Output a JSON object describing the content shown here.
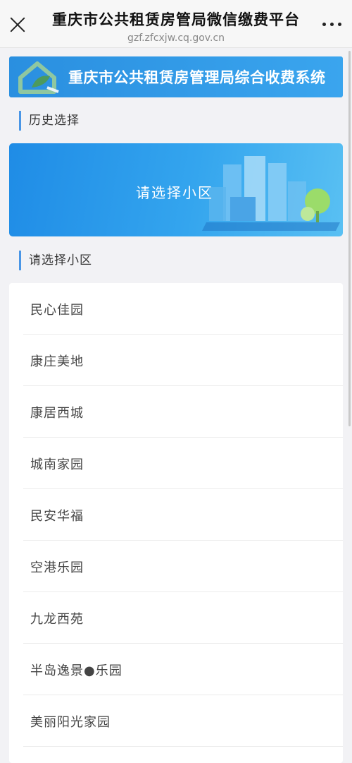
{
  "header": {
    "title": "重庆市公共租赁房管局微信缴费平台",
    "url": "gzf.zfcxjw.cq.gov.cn"
  },
  "banner": {
    "title": "重庆市公共租赁房管理局综合收费系统"
  },
  "history": {
    "heading": "历史选择",
    "card_label": "请选择小区"
  },
  "community": {
    "heading": "请选择小区",
    "items": [
      {
        "label": "民心佳园"
      },
      {
        "label": "康庄美地"
      },
      {
        "label": "康居西城"
      },
      {
        "label": "城南家园"
      },
      {
        "label": "民安华福"
      },
      {
        "label": "空港乐园"
      },
      {
        "label": "九龙西苑"
      },
      {
        "label": "半岛逸景●乐园"
      },
      {
        "label": "美丽阳光家园"
      }
    ]
  },
  "colors": {
    "accent": "#4a96e6",
    "banner": "#2a8fe0",
    "page_bg": "#f2f2f5"
  }
}
